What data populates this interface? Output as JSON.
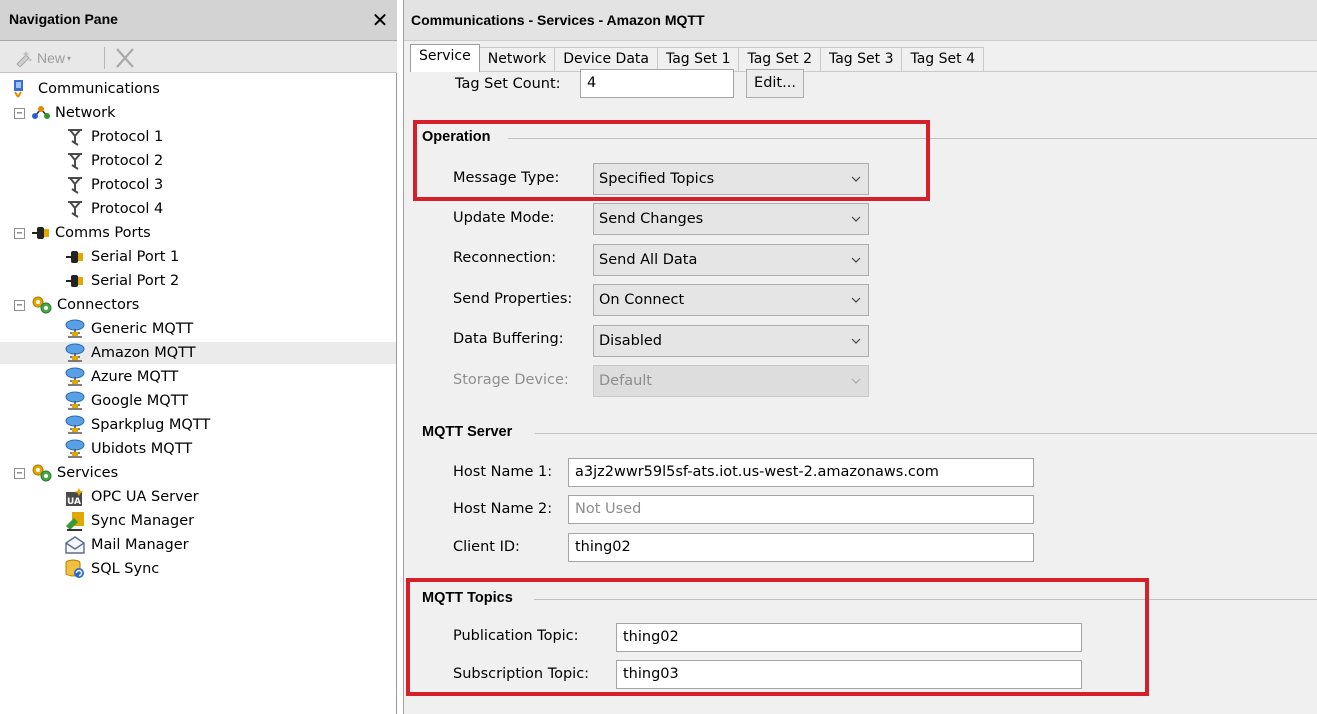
{
  "nav": {
    "title": "Navigation Pane",
    "close_glyph": "✕",
    "toolbar": {
      "new_label": "New",
      "new_caret": "▾"
    },
    "tree": [
      {
        "label": "Communications",
        "icon": "communications-icon"
      },
      {
        "label": "Network",
        "icon": "network-icon",
        "expander": "−"
      },
      {
        "label": "Protocol 1",
        "icon": "protocol-icon"
      },
      {
        "label": "Protocol 2",
        "icon": "protocol-icon"
      },
      {
        "label": "Protocol 3",
        "icon": "protocol-icon"
      },
      {
        "label": "Protocol 4",
        "icon": "protocol-icon"
      },
      {
        "label": "Comms Ports",
        "icon": "comms-ports-icon",
        "expander": "−"
      },
      {
        "label": "Serial Port 1",
        "icon": "serial-port-icon"
      },
      {
        "label": "Serial Port 2",
        "icon": "serial-port-icon"
      },
      {
        "label": "Connectors",
        "icon": "connectors-icon",
        "expander": "−"
      },
      {
        "label": "Generic MQTT",
        "icon": "mqtt-cloud-icon"
      },
      {
        "label": "Amazon MQTT",
        "icon": "mqtt-cloud-icon",
        "selected": true
      },
      {
        "label": "Azure MQTT",
        "icon": "mqtt-cloud-icon"
      },
      {
        "label": "Google MQTT",
        "icon": "mqtt-cloud-icon"
      },
      {
        "label": "Sparkplug MQTT",
        "icon": "mqtt-cloud-icon"
      },
      {
        "label": "Ubidots MQTT",
        "icon": "mqtt-cloud-icon"
      },
      {
        "label": "Services",
        "icon": "services-icon",
        "expander": "−"
      },
      {
        "label": "OPC UA Server",
        "icon": "opc-ua-icon"
      },
      {
        "label": "Sync Manager",
        "icon": "sync-manager-icon"
      },
      {
        "label": "Mail Manager",
        "icon": "mail-manager-icon"
      },
      {
        "label": "SQL Sync",
        "icon": "sql-sync-icon"
      }
    ]
  },
  "main": {
    "title": "Communications - Services - Amazon MQTT",
    "tabs": [
      "Service",
      "Network",
      "Device Data",
      "Tag Set 1",
      "Tag Set 2",
      "Tag Set 3",
      "Tag Set 4"
    ],
    "active_tab": "Service",
    "tag_set_count": {
      "label": "Tag Set Count:",
      "value": "4",
      "edit_label": "Edit..."
    },
    "operation": {
      "title": "Operation",
      "message_type": {
        "label": "Message Type:",
        "value": "Specified Topics"
      },
      "update_mode": {
        "label": "Update Mode:",
        "value": "Send Changes"
      },
      "reconnection": {
        "label": "Reconnection:",
        "value": "Send All Data"
      },
      "send_properties": {
        "label": "Send Properties:",
        "value": "On Connect"
      },
      "data_buffering": {
        "label": "Data Buffering:",
        "value": "Disabled"
      },
      "storage_device": {
        "label": "Storage Device:",
        "value": "Default"
      }
    },
    "mqtt_server": {
      "title": "MQTT Server",
      "host1": {
        "label": "Host Name 1:",
        "value": "a3jz2wwr59l5sf-ats.iot.us-west-2.amazonaws.com"
      },
      "host2": {
        "label": "Host Name 2:",
        "placeholder": "Not Used"
      },
      "client_id": {
        "label": "Client ID:",
        "value": "thing02"
      }
    },
    "mqtt_topics": {
      "title": "MQTT Topics",
      "publication": {
        "label": "Publication Topic:",
        "value": "thing02"
      },
      "subscription": {
        "label": "Subscription Topic:",
        "value": "thing03"
      }
    }
  },
  "colors": {
    "highlight": "#d3202a",
    "nav_header": "#d3d3d3",
    "panel": "#f0f0f0"
  }
}
